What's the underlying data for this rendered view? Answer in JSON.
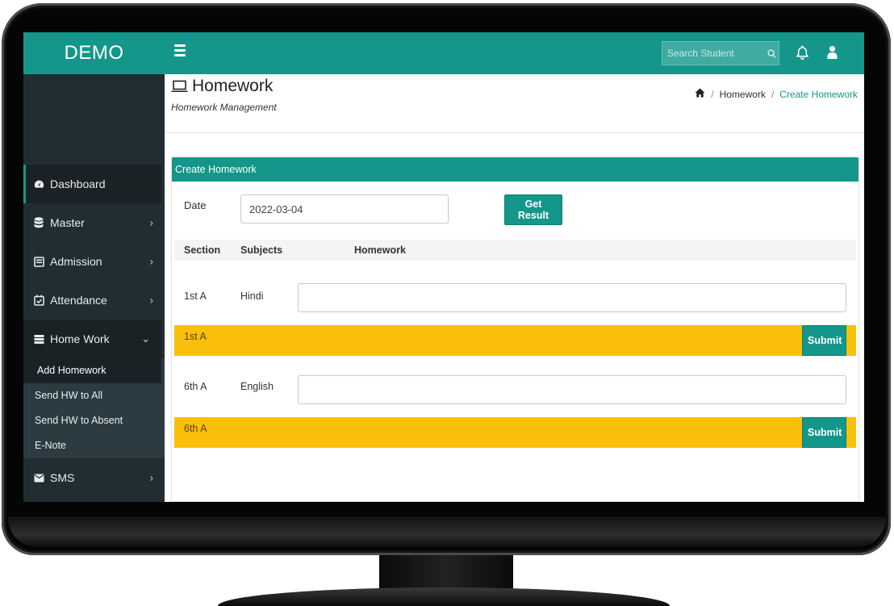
{
  "app": {
    "brand": "DEMO"
  },
  "colors": {
    "primary": "#14978a",
    "sidebar": "#222d32",
    "highlight": "#f9bf0a"
  },
  "topbar": {
    "menu_icon": "hamburger-icon",
    "search_placeholder": "Search Student",
    "search_icon": "search-icon",
    "notification_icon": "bell-icon",
    "user_icon": "user-icon"
  },
  "sidebar": {
    "items": [
      {
        "label": "Dashboard",
        "icon": "dashboard-icon"
      },
      {
        "label": "Master",
        "icon": "database-icon"
      },
      {
        "label": "Admission",
        "icon": "id-card-icon"
      },
      {
        "label": "Attendance",
        "icon": "calendar-check-icon"
      },
      {
        "label": "Home Work",
        "icon": "server-icon"
      },
      {
        "label": "SMS",
        "icon": "envelope-icon"
      }
    ],
    "homework_submenu": [
      "Add Homework",
      "Send HW to All",
      "Send HW to Absent",
      "E-Note"
    ]
  },
  "page": {
    "title": "Homework",
    "subtitle": "Homework Management",
    "breadcrumb": [
      "Homework",
      "Create Homework"
    ]
  },
  "form": {
    "box_title": "Create Homework",
    "date_label": "Date",
    "date_value": "2022-03-04",
    "get_result_label": "Get Result",
    "columns": [
      "Section",
      "Subjects",
      "Homework"
    ],
    "rows": [
      {
        "section": "1st A",
        "subject": "Hindi",
        "homework": "",
        "bar_label": "1st A",
        "submit_label": "Submit"
      },
      {
        "section": "6th A",
        "subject": "English",
        "homework": "",
        "bar_label": "6th A",
        "submit_label": "Submit"
      }
    ]
  }
}
